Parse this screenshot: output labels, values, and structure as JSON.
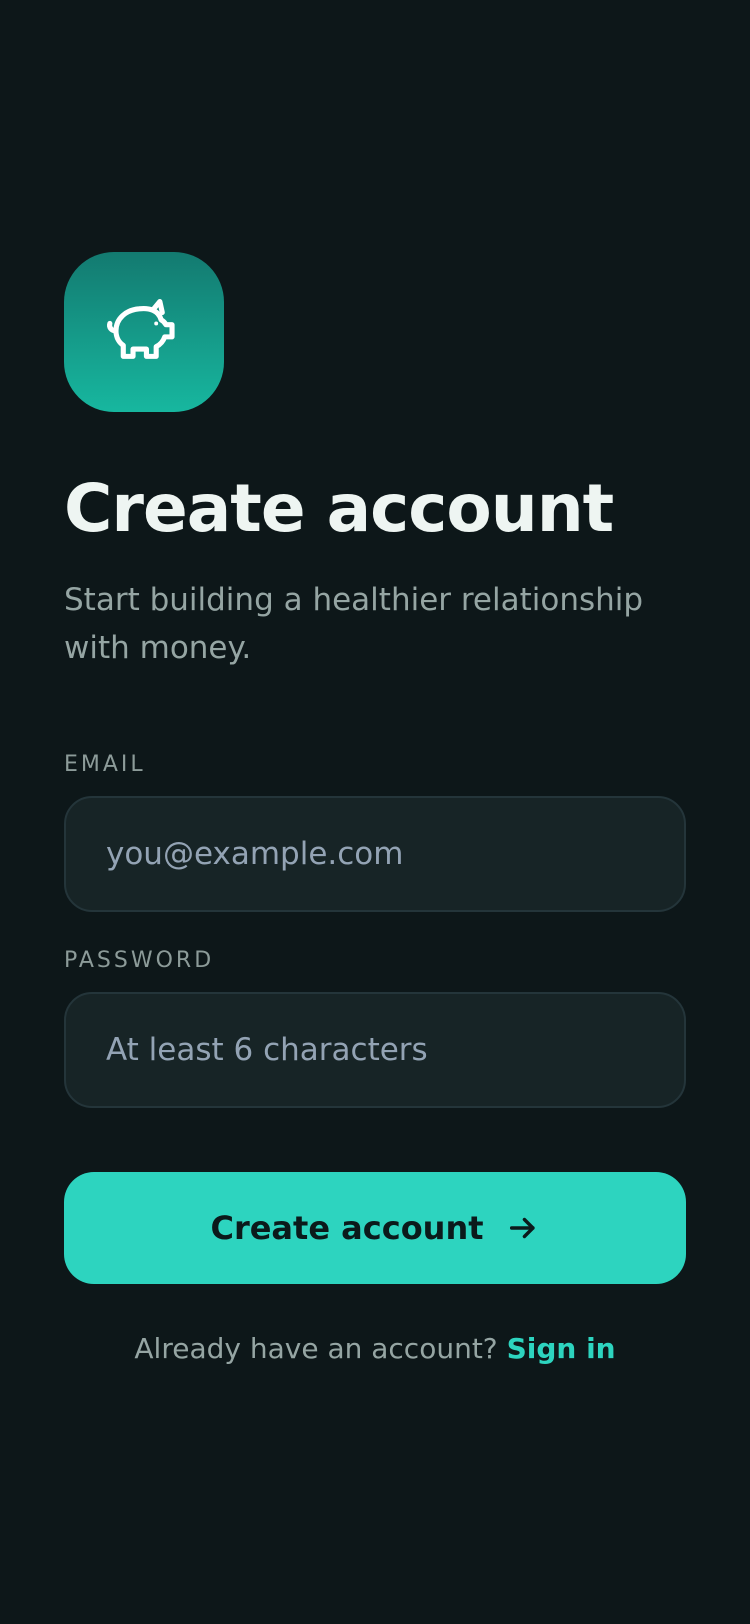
{
  "app": {
    "icon": "piggy-bank-icon",
    "accent_color": "#2dd4bf",
    "background_color": "#0d1719"
  },
  "header": {
    "title": "Create account",
    "subtitle": "Start building a healthier relationship with money."
  },
  "form": {
    "email": {
      "label": "EMAIL",
      "placeholder": "you@example.com",
      "value": ""
    },
    "password": {
      "label": "PASSWORD",
      "placeholder": "At least 6 characters",
      "value": ""
    },
    "submit": {
      "label": "Create account",
      "icon": "arrow-right-icon"
    }
  },
  "footer": {
    "prompt": "Already have an account?",
    "link_label": "Sign in"
  }
}
